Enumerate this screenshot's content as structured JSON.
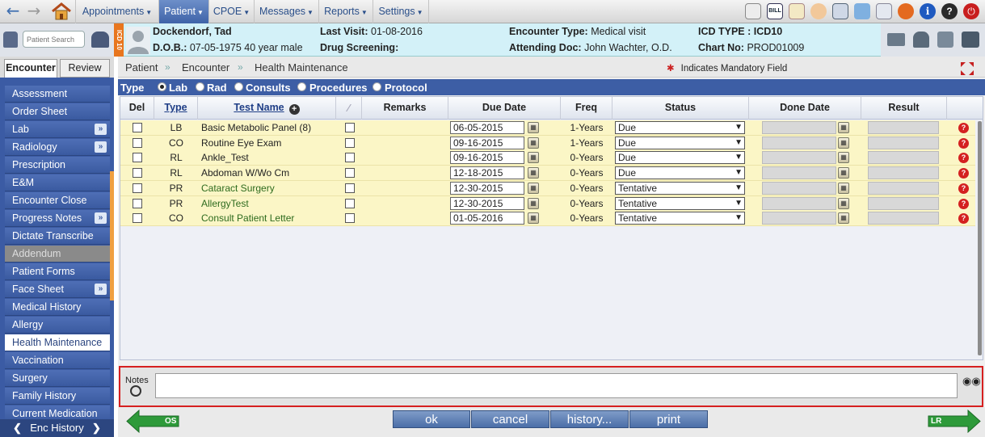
{
  "topnav": {
    "menus": [
      {
        "label": "Appointments"
      },
      {
        "label": "Patient"
      },
      {
        "label": "CPOE"
      },
      {
        "label": "Messages"
      },
      {
        "label": "Reports"
      },
      {
        "label": "Settings"
      }
    ],
    "active_menu": "Patient",
    "bill_icon_label": "BILL"
  },
  "patient_search": {
    "placeholder": "Patient Search"
  },
  "icd_strip": "ICD 10",
  "header": {
    "name": "Dockendorf, Tad",
    "dob_label": "D.O.B.:",
    "dob_value": "07-05-1975 40 year male",
    "last_visit_label": "Last Visit:",
    "last_visit_value": "01-08-2016",
    "drug_screening_label": "Drug Screening:",
    "encounter_type_label": "Encounter Type:",
    "encounter_type_value": "Medical visit",
    "attending_label": "Attending Doc:",
    "attending_value": "John Wachter, O.D.",
    "icd_type_label": "ICD TYPE :",
    "icd_type_value": "ICD10",
    "chart_no_label": "Chart No:",
    "chart_no_value": "PROD01009"
  },
  "left_tabs": {
    "encounter": "Encounter",
    "review": "Review"
  },
  "sidebar": {
    "items": [
      {
        "label": "Assessment",
        "more": false,
        "state": "normal"
      },
      {
        "label": "Order Sheet",
        "more": false,
        "state": "normal"
      },
      {
        "label": "Lab",
        "more": true,
        "state": "normal"
      },
      {
        "label": "Radiology",
        "more": true,
        "state": "normal"
      },
      {
        "label": "Prescription",
        "more": false,
        "state": "normal"
      },
      {
        "label": "E&M",
        "more": false,
        "state": "normal"
      },
      {
        "label": "Encounter Close",
        "more": false,
        "state": "normal"
      },
      {
        "label": "Progress Notes",
        "more": true,
        "state": "normal"
      },
      {
        "label": "Dictate Transcribe",
        "more": false,
        "state": "normal"
      },
      {
        "label": "Addendum",
        "more": false,
        "state": "disabled"
      },
      {
        "label": "Patient Forms",
        "more": false,
        "state": "normal"
      },
      {
        "label": "Face Sheet",
        "more": true,
        "state": "normal"
      },
      {
        "label": "Medical History",
        "more": false,
        "state": "normal"
      },
      {
        "label": "Allergy",
        "more": false,
        "state": "normal"
      },
      {
        "label": "Health Maintenance",
        "more": false,
        "state": "active"
      },
      {
        "label": "Vaccination",
        "more": false,
        "state": "normal"
      },
      {
        "label": "Surgery",
        "more": false,
        "state": "normal"
      },
      {
        "label": "Family History",
        "more": false,
        "state": "normal"
      },
      {
        "label": "Current Medication",
        "more": false,
        "state": "normal"
      }
    ],
    "more_glyph": "»",
    "enc_history": "Enc History"
  },
  "breadcrumb": {
    "items": [
      "Patient",
      "Encounter",
      "Health Maintenance"
    ],
    "separator": "»"
  },
  "mandatory_note": "Indicates Mandatory Field",
  "typebar": {
    "label": "Type",
    "options": [
      "Lab",
      "Rad",
      "Consults",
      "Procedures",
      "Protocol"
    ],
    "selected": "Lab"
  },
  "grid": {
    "headers": {
      "del": "Del",
      "type": "Type",
      "test_name": "Test Name",
      "remarks": "Remarks",
      "due_date": "Due Date",
      "freq": "Freq",
      "status": "Status",
      "done_date": "Done Date",
      "result": "Result"
    },
    "rows": [
      {
        "type": "LB",
        "test_name": "Basic Metabolic Panel (8)",
        "due_date": "06-05-2015",
        "freq": "1-Years",
        "status": "Due",
        "name_color": "#222222"
      },
      {
        "type": "CO",
        "test_name": "Routine Eye Exam",
        "due_date": "09-16-2015",
        "freq": "1-Years",
        "status": "Due",
        "name_color": "#222222"
      },
      {
        "type": "RL",
        "test_name": "Ankle_Test",
        "due_date": "09-16-2015",
        "freq": "0-Years",
        "status": "Due",
        "name_color": "#222222"
      },
      {
        "type": "RL",
        "test_name": "Abdoman W/Wo Cm",
        "due_date": "12-18-2015",
        "freq": "0-Years",
        "status": "Due",
        "name_color": "#222222"
      },
      {
        "type": "PR",
        "test_name": "Cataract Surgery",
        "due_date": "12-30-2015",
        "freq": "0-Years",
        "status": "Tentative",
        "name_color": "#2e6b1e"
      },
      {
        "type": "PR",
        "test_name": "AllergyTest",
        "due_date": "12-30-2015",
        "freq": "0-Years",
        "status": "Tentative",
        "name_color": "#2e6b1e"
      },
      {
        "type": "CO",
        "test_name": "Consult Patient Letter",
        "due_date": "01-05-2016",
        "freq": "0-Years",
        "status": "Tentative",
        "name_color": "#2e6b1e"
      }
    ]
  },
  "notes": {
    "label": "Notes",
    "value": ""
  },
  "buttons": {
    "ok": "ok",
    "cancel": "cancel",
    "history": "history...",
    "print": "print",
    "os": "OS",
    "lr": "LR"
  },
  "colors": {
    "accent": "#3d5ea5",
    "row_bg": "#fbf6c6",
    "notes_border": "#d62020"
  }
}
